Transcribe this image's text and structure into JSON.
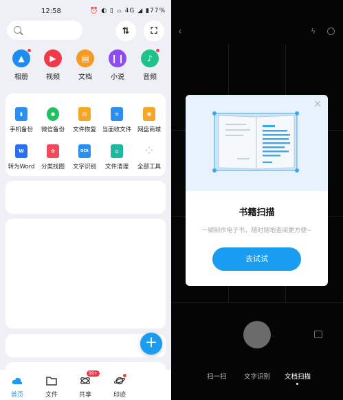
{
  "status": {
    "time": "12:58",
    "icons": "⏰ ◐ ▯ ⌓ 4G ◢ ▮77%"
  },
  "search": {
    "placeholder": ""
  },
  "header": {
    "transfer_icon": "⇅",
    "scan_icon": "⛶"
  },
  "top_apps": [
    {
      "label": "相册",
      "color": "#1f8cf0",
      "icon": "▲",
      "badge": true
    },
    {
      "label": "视频",
      "color": "#f2394a",
      "icon": "▶",
      "badge": false
    },
    {
      "label": "文档",
      "color": "#f59a23",
      "icon": "▤",
      "badge": false
    },
    {
      "label": "小说",
      "color": "#8e4df0",
      "icon": "❙❙",
      "badge": false
    },
    {
      "label": "音频",
      "color": "#20c18a",
      "icon": "♪",
      "badge": true
    }
  ],
  "tools": [
    {
      "label": "手机备份",
      "color": "#2a8ff0",
      "icon": "▮"
    },
    {
      "label": "微信备份",
      "color": "#20c160",
      "icon": "●"
    },
    {
      "label": "文件恢复",
      "color": "#f5a623",
      "icon": "▤"
    },
    {
      "label": "当面收文件",
      "color": "#2a8ff0",
      "icon": "≡"
    },
    {
      "label": "网盘商城",
      "color": "#f5a623",
      "icon": "▣"
    },
    {
      "label": "转为Word",
      "color": "#2a6ff0",
      "icon": "W"
    },
    {
      "label": "分类找图",
      "color": "#f24a5a",
      "icon": "✿"
    },
    {
      "label": "文字识别",
      "color": "#2a8ff0",
      "icon": "OCR"
    },
    {
      "label": "文件清理",
      "color": "#20b8a0",
      "icon": "⌂"
    },
    {
      "label": "全部工具",
      "color": "#cccccc",
      "icon": "⁘"
    }
  ],
  "tabs": [
    {
      "label": "首页",
      "active": true
    },
    {
      "label": "文件",
      "active": false
    },
    {
      "label": "共享",
      "active": false,
      "badge": "99+"
    },
    {
      "label": "印迹",
      "active": false
    }
  ],
  "modal": {
    "title": "书籍扫描",
    "subtitle": "一键制作电子书，随时随地查阅更方便~",
    "cta": "去试试",
    "close": "✕"
  },
  "camera_modes": [
    "扫一扫",
    "文字识别",
    "文档扫描"
  ],
  "colors": {
    "accent": "#1a9cf0",
    "bg_left": "#eef0f6",
    "bg_right": "#050505"
  }
}
